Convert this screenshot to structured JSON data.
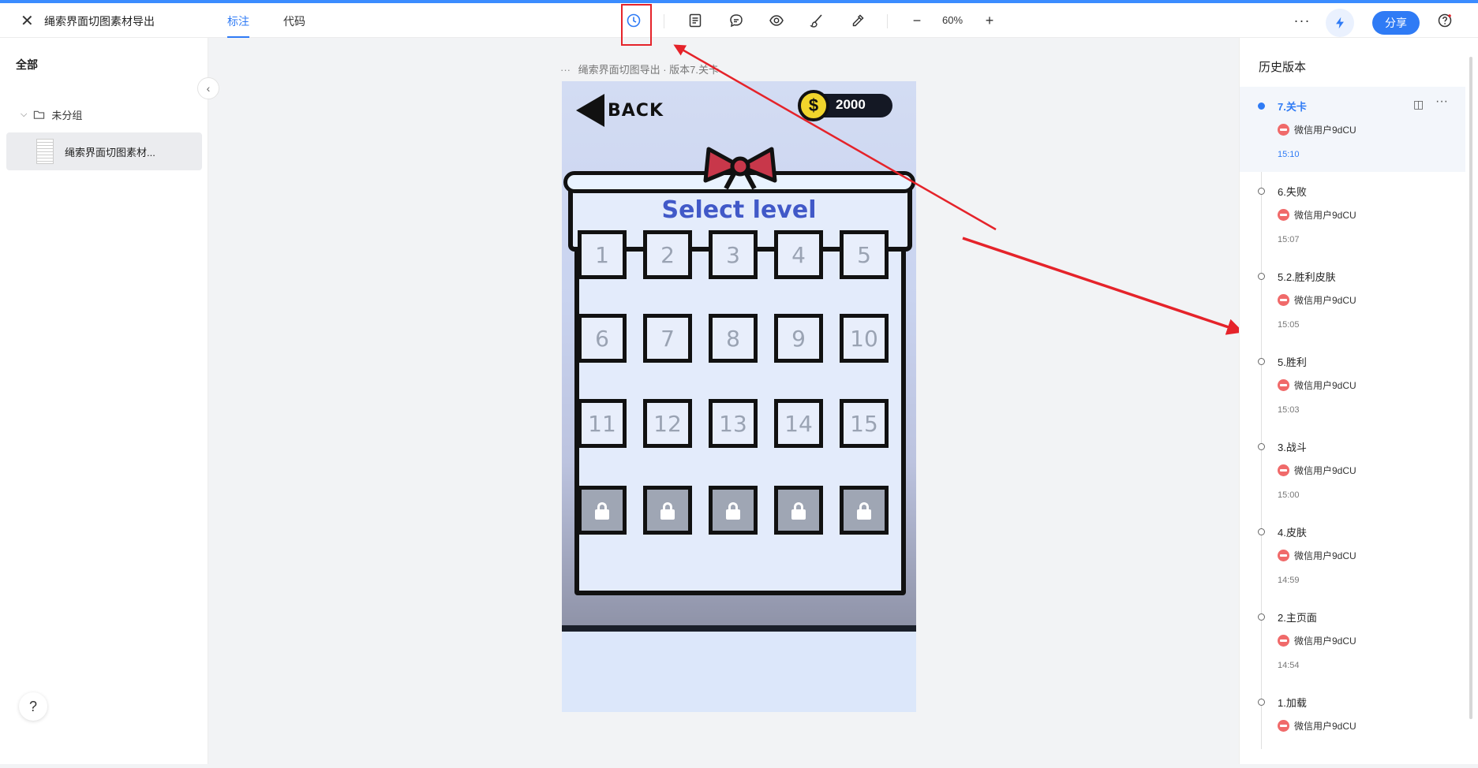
{
  "header": {
    "title": "绳索界面切图素材导出",
    "tabs": [
      {
        "label": "标注",
        "active": true
      },
      {
        "label": "代码",
        "active": false
      }
    ],
    "zoom": "60%",
    "share_label": "分享",
    "accent_color": "#2f7bf5",
    "tool_icons": [
      "history-icon",
      "notes-icon",
      "comment-icon",
      "eye-icon",
      "brush-icon",
      "eyedropper-icon"
    ]
  },
  "sidebar": {
    "all_label": "全部",
    "group_label": "未分组",
    "file_name": "绳索界面切图素材..."
  },
  "canvas": {
    "label": "绳索界面切图导出 · 版本7.关卡",
    "back_label": "BACK",
    "coins": "2000",
    "coin_symbol": "$",
    "select_title": "Select level",
    "levels": [
      "1",
      "2",
      "3",
      "4",
      "5",
      "6",
      "7",
      "8",
      "9",
      "10",
      "11",
      "12",
      "13",
      "14",
      "15"
    ],
    "locked_count": 5
  },
  "history": {
    "heading": "历史版本",
    "versions": [
      {
        "name": "7.关卡",
        "user": "微信用户9dCU",
        "time": "15:10",
        "active": true
      },
      {
        "name": "6.失败",
        "user": "微信用户9dCU",
        "time": "15:07",
        "active": false
      },
      {
        "name": "5.2.胜利皮肤",
        "user": "微信用户9dCU",
        "time": "15:05",
        "active": false
      },
      {
        "name": "5.胜利",
        "user": "微信用户9dCU",
        "time": "15:03",
        "active": false
      },
      {
        "name": "3.战斗",
        "user": "微信用户9dCU",
        "time": "15:00",
        "active": false
      },
      {
        "name": "4.皮肤",
        "user": "微信用户9dCU",
        "time": "14:59",
        "active": false
      },
      {
        "name": "2.主页面",
        "user": "微信用户9dCU",
        "time": "14:54",
        "active": false
      },
      {
        "name": "1.加载",
        "user": "微信用户9dCU",
        "time": "",
        "active": false
      }
    ]
  },
  "annotation_color": "#e5232a"
}
